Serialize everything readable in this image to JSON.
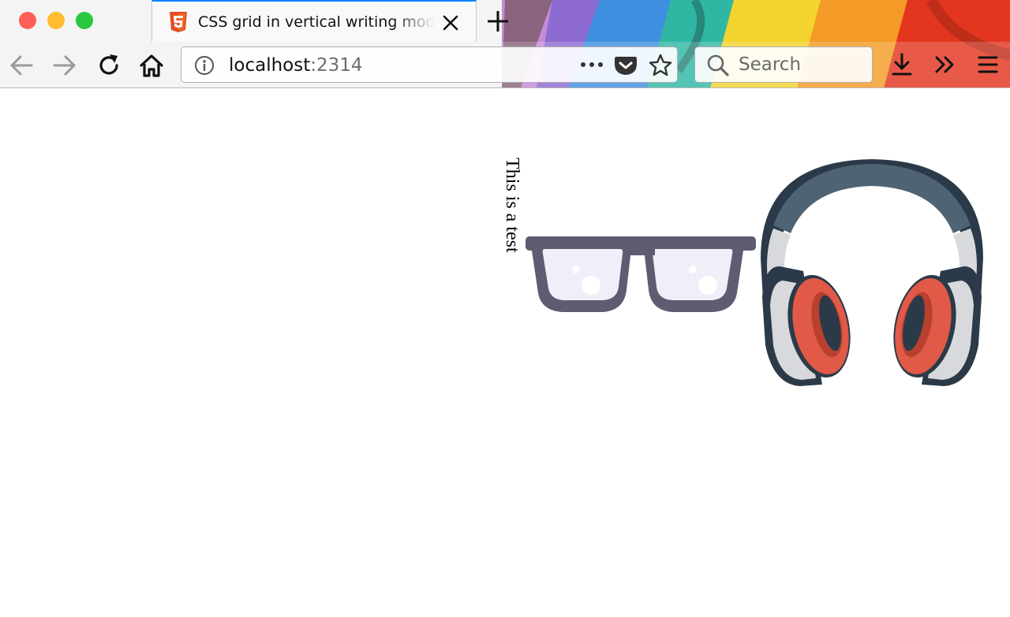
{
  "window": {
    "controls": [
      "close",
      "minimize",
      "maximize"
    ]
  },
  "tab": {
    "title": "CSS grid in vertical writing mode",
    "favicon": "html5-icon"
  },
  "toolbar": {
    "url_host": "localhost",
    "url_port": ":2314",
    "search_placeholder": "Search"
  },
  "icons": {
    "back": "back-arrow-icon",
    "forward": "forward-arrow-icon",
    "reload": "reload-icon",
    "home": "home-icon",
    "info": "info-icon",
    "page_actions": "more-dots-icon",
    "pocket": "pocket-icon",
    "bookmark": "star-icon",
    "search": "search-icon",
    "downloads": "download-icon",
    "overflow": "overflow-chevron-icon",
    "menu": "hamburger-menu-icon"
  },
  "page": {
    "vertical_text": "This is a test",
    "images": [
      "glasses",
      "headphones"
    ]
  },
  "colors": {
    "accent_tab": "#0a84ff",
    "headphone_cushion": "#e05a47",
    "headphone_band": "#4e6374",
    "glasses_frame": "#5e5c70"
  }
}
